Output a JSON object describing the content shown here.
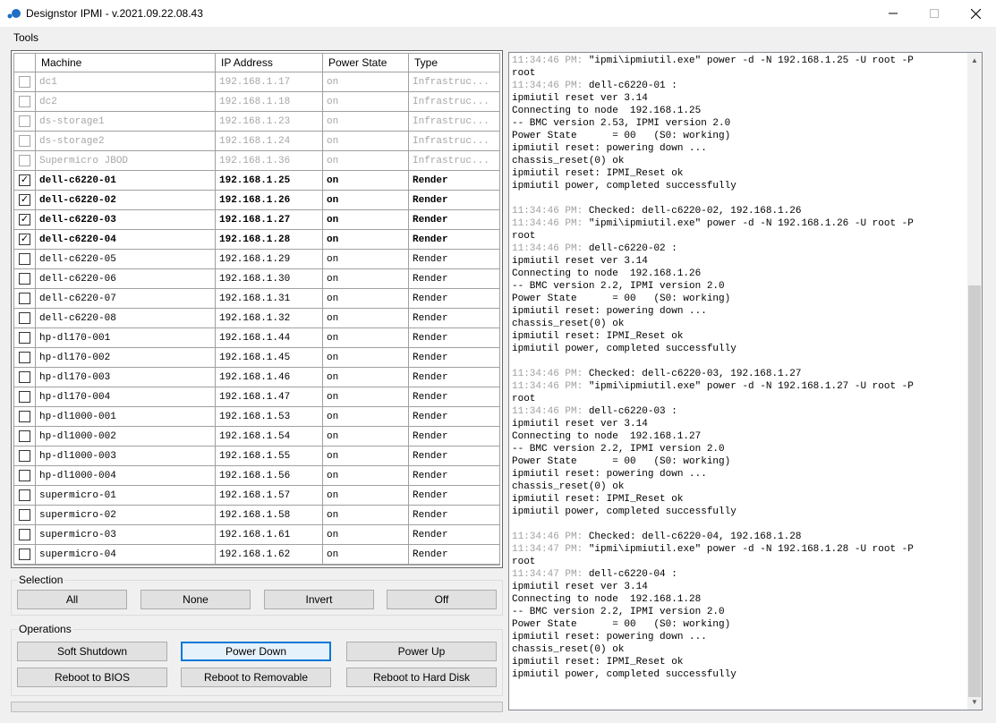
{
  "window": {
    "title": "Designstor IPMI - v.2021.09.22.08.43"
  },
  "menu": {
    "tools": "Tools"
  },
  "grid": {
    "columns": [
      "Machine",
      "IP Address",
      "Power State",
      "Type"
    ],
    "rows": [
      {
        "checked": false,
        "disabled": true,
        "machine": "dc1",
        "ip": "192.168.1.17",
        "state": "on",
        "type": "Infrastruc..."
      },
      {
        "checked": false,
        "disabled": true,
        "machine": "dc2",
        "ip": "192.168.1.18",
        "state": "on",
        "type": "Infrastruc..."
      },
      {
        "checked": false,
        "disabled": true,
        "machine": "ds-storage1",
        "ip": "192.168.1.23",
        "state": "on",
        "type": "Infrastruc..."
      },
      {
        "checked": false,
        "disabled": true,
        "machine": "ds-storage2",
        "ip": "192.168.1.24",
        "state": "on",
        "type": "Infrastruc..."
      },
      {
        "checked": false,
        "disabled": true,
        "machine": "Supermicro JBOD",
        "ip": "192.168.1.36",
        "state": "on",
        "type": "Infrastruc..."
      },
      {
        "checked": true,
        "disabled": false,
        "machine": "dell-c6220-01",
        "ip": "192.168.1.25",
        "state": "on",
        "type": "Render"
      },
      {
        "checked": true,
        "disabled": false,
        "machine": "dell-c6220-02",
        "ip": "192.168.1.26",
        "state": "on",
        "type": "Render"
      },
      {
        "checked": true,
        "disabled": false,
        "machine": "dell-c6220-03",
        "ip": "192.168.1.27",
        "state": "on",
        "type": "Render"
      },
      {
        "checked": true,
        "disabled": false,
        "machine": "dell-c6220-04",
        "ip": "192.168.1.28",
        "state": "on",
        "type": "Render"
      },
      {
        "checked": false,
        "disabled": false,
        "machine": "dell-c6220-05",
        "ip": "192.168.1.29",
        "state": "on",
        "type": "Render"
      },
      {
        "checked": false,
        "disabled": false,
        "machine": "dell-c6220-06",
        "ip": "192.168.1.30",
        "state": "on",
        "type": "Render"
      },
      {
        "checked": false,
        "disabled": false,
        "machine": "dell-c6220-07",
        "ip": "192.168.1.31",
        "state": "on",
        "type": "Render"
      },
      {
        "checked": false,
        "disabled": false,
        "machine": "dell-c6220-08",
        "ip": "192.168.1.32",
        "state": "on",
        "type": "Render"
      },
      {
        "checked": false,
        "disabled": false,
        "machine": "hp-dl170-001",
        "ip": "192.168.1.44",
        "state": "on",
        "type": "Render"
      },
      {
        "checked": false,
        "disabled": false,
        "machine": "hp-dl170-002",
        "ip": "192.168.1.45",
        "state": "on",
        "type": "Render"
      },
      {
        "checked": false,
        "disabled": false,
        "machine": "hp-dl170-003",
        "ip": "192.168.1.46",
        "state": "on",
        "type": "Render"
      },
      {
        "checked": false,
        "disabled": false,
        "machine": "hp-dl170-004",
        "ip": "192.168.1.47",
        "state": "on",
        "type": "Render"
      },
      {
        "checked": false,
        "disabled": false,
        "machine": "hp-dl1000-001",
        "ip": "192.168.1.53",
        "state": "on",
        "type": "Render"
      },
      {
        "checked": false,
        "disabled": false,
        "machine": "hp-dl1000-002",
        "ip": "192.168.1.54",
        "state": "on",
        "type": "Render"
      },
      {
        "checked": false,
        "disabled": false,
        "machine": "hp-dl1000-003",
        "ip": "192.168.1.55",
        "state": "on",
        "type": "Render"
      },
      {
        "checked": false,
        "disabled": false,
        "machine": "hp-dl1000-004",
        "ip": "192.168.1.56",
        "state": "on",
        "type": "Render"
      },
      {
        "checked": false,
        "disabled": false,
        "machine": "supermicro-01",
        "ip": "192.168.1.57",
        "state": "on",
        "type": "Render"
      },
      {
        "checked": false,
        "disabled": false,
        "machine": "supermicro-02",
        "ip": "192.168.1.58",
        "state": "on",
        "type": "Render"
      },
      {
        "checked": false,
        "disabled": false,
        "machine": "supermicro-03",
        "ip": "192.168.1.61",
        "state": "on",
        "type": "Render"
      },
      {
        "checked": false,
        "disabled": false,
        "machine": "supermicro-04",
        "ip": "192.168.1.62",
        "state": "on",
        "type": "Render"
      }
    ]
  },
  "selection": {
    "label": "Selection",
    "all": "All",
    "none": "None",
    "invert": "Invert",
    "off": "Off"
  },
  "operations": {
    "label": "Operations",
    "soft_shutdown": "Soft Shutdown",
    "power_down": "Power Down",
    "power_up": "Power Up",
    "reboot_bios": "Reboot to BIOS",
    "reboot_removable": "Reboot to Removable",
    "reboot_hdd": "Reboot to Hard Disk"
  },
  "log": {
    "lines": [
      {
        "ts": "11:34:46 PM: ",
        "text": "\"ipmi\\ipmiutil.exe\" power -d -N 192.168.1.25 -U root -P"
      },
      {
        "ts": "",
        "text": "root"
      },
      {
        "ts": "11:34:46 PM: ",
        "text": "dell-c6220-01 :"
      },
      {
        "ts": "",
        "text": "ipmiutil reset ver 3.14"
      },
      {
        "ts": "",
        "text": "Connecting to node  192.168.1.25"
      },
      {
        "ts": "",
        "text": "-- BMC version 2.53, IPMI version 2.0"
      },
      {
        "ts": "",
        "text": "Power State      = 00   (S0: working)"
      },
      {
        "ts": "",
        "text": "ipmiutil reset: powering down ..."
      },
      {
        "ts": "",
        "text": "chassis_reset(0) ok"
      },
      {
        "ts": "",
        "text": "ipmiutil reset: IPMI_Reset ok"
      },
      {
        "ts": "",
        "text": "ipmiutil power, completed successfully"
      },
      {
        "ts": "",
        "text": ""
      },
      {
        "ts": "11:34:46 PM: ",
        "text": "Checked: dell-c6220-02, 192.168.1.26"
      },
      {
        "ts": "11:34:46 PM: ",
        "text": "\"ipmi\\ipmiutil.exe\" power -d -N 192.168.1.26 -U root -P"
      },
      {
        "ts": "",
        "text": "root"
      },
      {
        "ts": "11:34:46 PM: ",
        "text": "dell-c6220-02 :"
      },
      {
        "ts": "",
        "text": "ipmiutil reset ver 3.14"
      },
      {
        "ts": "",
        "text": "Connecting to node  192.168.1.26"
      },
      {
        "ts": "",
        "text": "-- BMC version 2.2, IPMI version 2.0"
      },
      {
        "ts": "",
        "text": "Power State      = 00   (S0: working)"
      },
      {
        "ts": "",
        "text": "ipmiutil reset: powering down ..."
      },
      {
        "ts": "",
        "text": "chassis_reset(0) ok"
      },
      {
        "ts": "",
        "text": "ipmiutil reset: IPMI_Reset ok"
      },
      {
        "ts": "",
        "text": "ipmiutil power, completed successfully"
      },
      {
        "ts": "",
        "text": ""
      },
      {
        "ts": "11:34:46 PM: ",
        "text": "Checked: dell-c6220-03, 192.168.1.27"
      },
      {
        "ts": "11:34:46 PM: ",
        "text": "\"ipmi\\ipmiutil.exe\" power -d -N 192.168.1.27 -U root -P"
      },
      {
        "ts": "",
        "text": "root"
      },
      {
        "ts": "11:34:46 PM: ",
        "text": "dell-c6220-03 :"
      },
      {
        "ts": "",
        "text": "ipmiutil reset ver 3.14"
      },
      {
        "ts": "",
        "text": "Connecting to node  192.168.1.27"
      },
      {
        "ts": "",
        "text": "-- BMC version 2.2, IPMI version 2.0"
      },
      {
        "ts": "",
        "text": "Power State      = 00   (S0: working)"
      },
      {
        "ts": "",
        "text": "ipmiutil reset: powering down ..."
      },
      {
        "ts": "",
        "text": "chassis_reset(0) ok"
      },
      {
        "ts": "",
        "text": "ipmiutil reset: IPMI_Reset ok"
      },
      {
        "ts": "",
        "text": "ipmiutil power, completed successfully"
      },
      {
        "ts": "",
        "text": ""
      },
      {
        "ts": "11:34:46 PM: ",
        "text": "Checked: dell-c6220-04, 192.168.1.28"
      },
      {
        "ts": "11:34:47 PM: ",
        "text": "\"ipmi\\ipmiutil.exe\" power -d -N 192.168.1.28 -U root -P"
      },
      {
        "ts": "",
        "text": "root"
      },
      {
        "ts": "11:34:47 PM: ",
        "text": "dell-c6220-04 :"
      },
      {
        "ts": "",
        "text": "ipmiutil reset ver 3.14"
      },
      {
        "ts": "",
        "text": "Connecting to node  192.168.1.28"
      },
      {
        "ts": "",
        "text": "-- BMC version 2.2, IPMI version 2.0"
      },
      {
        "ts": "",
        "text": "Power State      = 00   (S0: working)"
      },
      {
        "ts": "",
        "text": "ipmiutil reset: powering down ..."
      },
      {
        "ts": "",
        "text": "chassis_reset(0) ok"
      },
      {
        "ts": "",
        "text": "ipmiutil reset: IPMI_Reset ok"
      },
      {
        "ts": "",
        "text": "ipmiutil power, completed successfully"
      }
    ]
  },
  "icons": {
    "app": "app-logo-icon",
    "minimize": "minimize-icon",
    "maximize": "maximize-icon",
    "close": "close-icon",
    "check": "checkmark-icon"
  },
  "colors": {
    "accent": "#0078d7",
    "disabled_text": "#a6a6a6",
    "timestamp": "#a0a0a0",
    "app_icon": "#1f6fc5"
  }
}
